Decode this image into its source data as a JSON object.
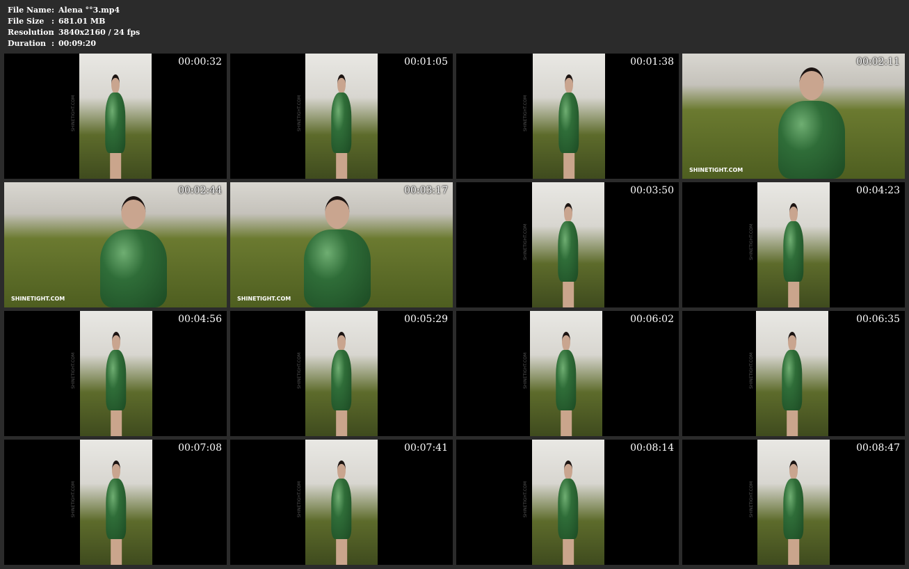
{
  "info": [
    {
      "key": "File Name",
      "sep": ":",
      "value": "Alena °°3.mp4"
    },
    {
      "key": "File Size",
      "sep": ":",
      "value": "681.01 MB"
    },
    {
      "key": "Resolution",
      "sep": ":",
      "value": "3840x2160 / 24 fps"
    },
    {
      "key": "Duration",
      "sep": ":",
      "value": "00:09:20"
    }
  ],
  "thumbnails": [
    {
      "time": "00:00:32",
      "watermark": "SHINETIGHT.COM"
    },
    {
      "time": "00:01:05",
      "watermark": "SHINETIGHT.COM"
    },
    {
      "time": "00:01:38",
      "watermark": "SHINETIGHT.COM"
    },
    {
      "time": "00:02:11",
      "watermark": "SHINETIGHT.COM"
    },
    {
      "time": "00:02:44",
      "watermark": "SHINETIGHT.COM"
    },
    {
      "time": "00:03:17",
      "watermark": "SHINETIGHT.COM"
    },
    {
      "time": "00:03:50",
      "watermark": "SHINETIGHT.COM"
    },
    {
      "time": "00:04:23",
      "watermark": "SHINETIGHT.COM"
    },
    {
      "time": "00:04:56",
      "watermark": "SHINETIGHT.COM"
    },
    {
      "time": "00:05:29",
      "watermark": "SHINETIGHT.COM"
    },
    {
      "time": "00:06:02",
      "watermark": "SHINETIGHT.COM"
    },
    {
      "time": "00:06:35",
      "watermark": "SHINETIGHT.COM"
    },
    {
      "time": "00:07:08",
      "watermark": "SHINETIGHT.COM"
    },
    {
      "time": "00:07:41",
      "watermark": "SHINETIGHT.COM"
    },
    {
      "time": "00:08:14",
      "watermark": "SHINETIGHT.COM"
    },
    {
      "time": "00:08:47",
      "watermark": "SHINETIGHT.COM"
    }
  ]
}
